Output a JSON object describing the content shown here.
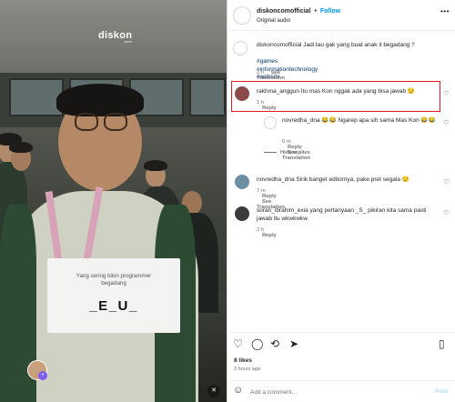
{
  "video": {
    "brand_text": "disk",
    "brand_suffix": "on",
    "brand_sub": ".com",
    "sign_text": "Yang sering bikin programmer begadang",
    "sign_puzzle": "_E_U_",
    "mute_icon": "speaker-muted-icon"
  },
  "header": {
    "username": "diskoncomofficial",
    "separator": "•",
    "follow_label": "Follow",
    "audio": "Original audio",
    "more_icon": "•••"
  },
  "caption": {
    "username": "diskoncomofficial",
    "text": "Jadi tau gak yang buat anak it begadang ?",
    "hashtags": "#games #informationtechnology #website",
    "time": "3 h",
    "see_translation": "See Translation"
  },
  "comments": [
    {
      "username": "rakhma_anggun",
      "text": "Itu mas Kon nggak ada yang bisa jawab 😒",
      "time": "1 h",
      "reply": "Reply",
      "highlighted": true
    },
    {
      "username": "novredha_dna",
      "text": "😂😂 Ngarep apa sih sama Mas Kon 😂😂",
      "time": "6 m",
      "reply": "Reply",
      "see_translation": "See Translation"
    },
    {
      "username": "novredha_dna",
      "text": "Sirik banget editornya, pake pret segala 😒",
      "time": "7 m",
      "reply": "Reply",
      "see_translation": "See Translation"
    },
    {
      "username": "soran_ibrahim_exia",
      "text": "yang pertanyaan _S_ pikiran kita sama pasti jawab itu wkwkwkw",
      "time": "2 h",
      "reply": "Reply"
    }
  ],
  "hide_replies": "Hide replies",
  "actions": {
    "likes": "8 likes",
    "time_ago": "3 hours ago"
  },
  "add_comment": {
    "placeholder": "Add a comment…",
    "post_label": "Post"
  },
  "colors": {
    "highlight": "#e21b23",
    "follow": "#0095f6",
    "hashtag": "#00376b"
  }
}
